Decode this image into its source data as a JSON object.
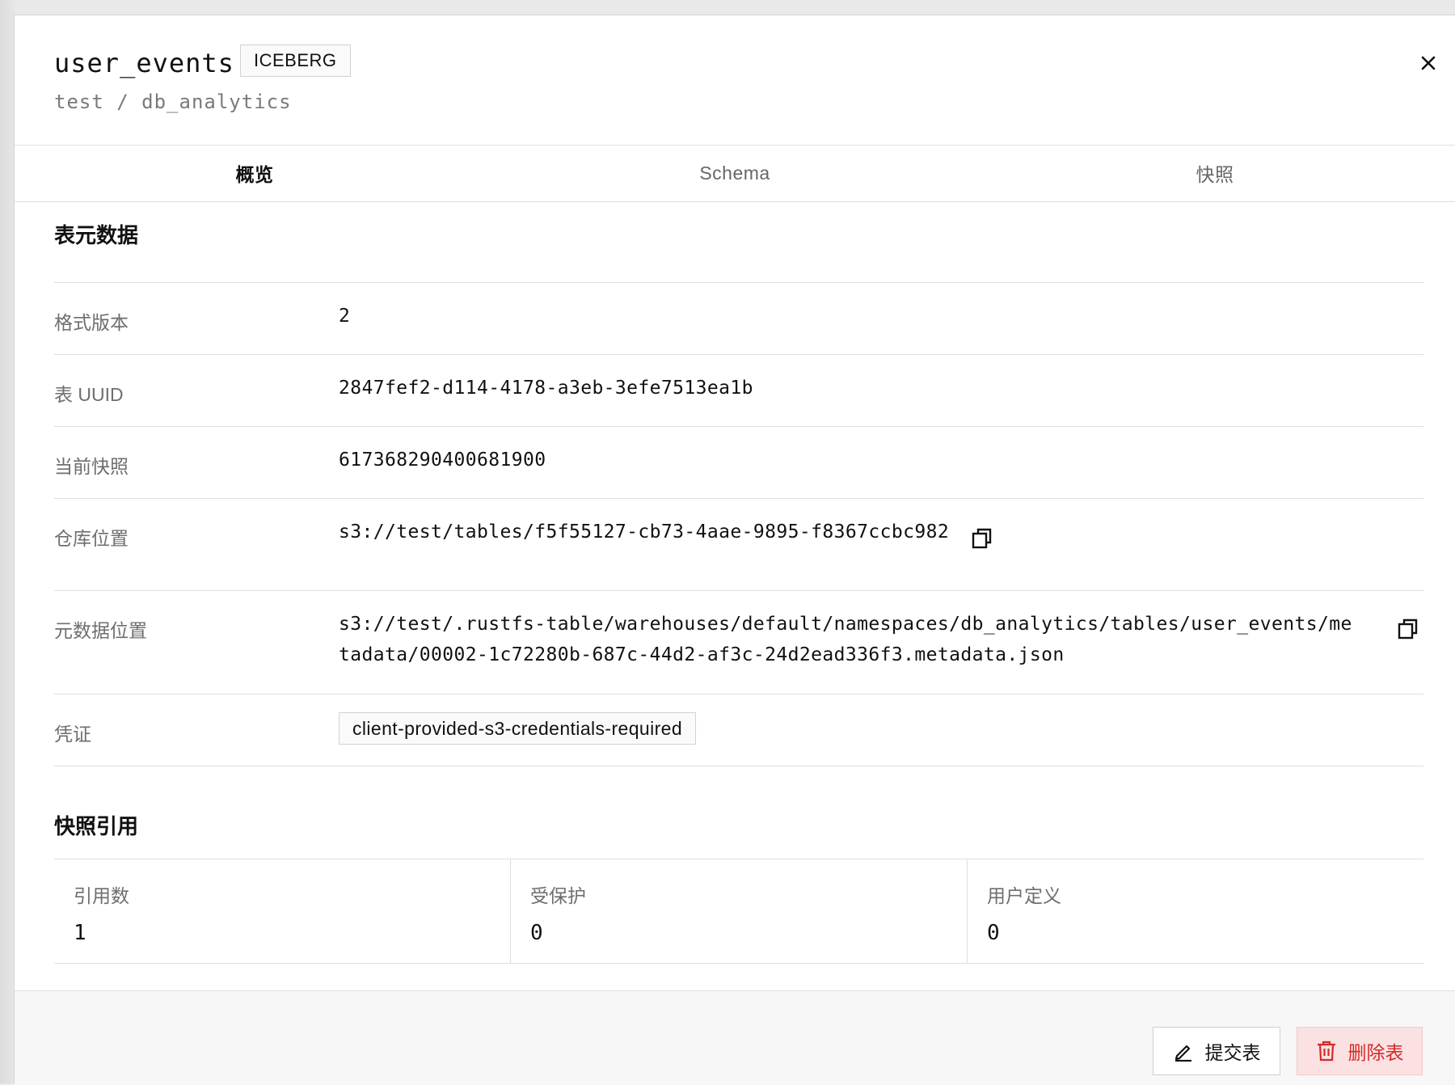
{
  "header": {
    "title": "user_events",
    "badge": "ICEBERG",
    "breadcrumb": "test / db_analytics",
    "close_icon": "close-icon"
  },
  "tabs": [
    {
      "label": "概览",
      "active": true
    },
    {
      "label": "Schema",
      "active": false
    },
    {
      "label": "快照",
      "active": false
    }
  ],
  "metadata": {
    "section_title": "表元数据",
    "rows": {
      "format_version": {
        "label": "格式版本",
        "value": "2"
      },
      "table_uuid": {
        "label": "表 UUID",
        "value": "2847fef2-d114-4178-a3eb-3efe7513ea1b"
      },
      "current_snapshot": {
        "label": "当前快照",
        "value": "617368290400681900"
      },
      "warehouse_location": {
        "label": "仓库位置",
        "value": "s3://test/tables/f5f55127-cb73-4aae-9895-f8367ccbc982",
        "icon": "copy-icon"
      },
      "metadata_location": {
        "label": "元数据位置",
        "value_line1": "s3://test/.rustfs-table/warehouses/default/namespaces/db_analytics/tables/user_events/me",
        "value_line2": "tadata/00002-1c72280b-687c-44d2-af3c-24d2ead336f3.metadata.json",
        "icon": "copy-icon"
      },
      "credentials": {
        "label": "凭证",
        "value": "client-provided-s3-credentials-required"
      }
    }
  },
  "snapshot_refs": {
    "section_title": "快照引用",
    "cells": [
      {
        "label": "引用数",
        "value": "1"
      },
      {
        "label": "受保护",
        "value": "0"
      },
      {
        "label": "用户定义",
        "value": "0"
      }
    ]
  },
  "footer": {
    "commit_label": "提交表",
    "commit_icon": "pencil-icon",
    "delete_label": "删除表",
    "delete_icon": "trash-icon"
  },
  "colors": {
    "danger": "#d42a2a",
    "danger_bg": "#fbe1e1",
    "text": "#111111",
    "muted": "#6e6e6e"
  }
}
